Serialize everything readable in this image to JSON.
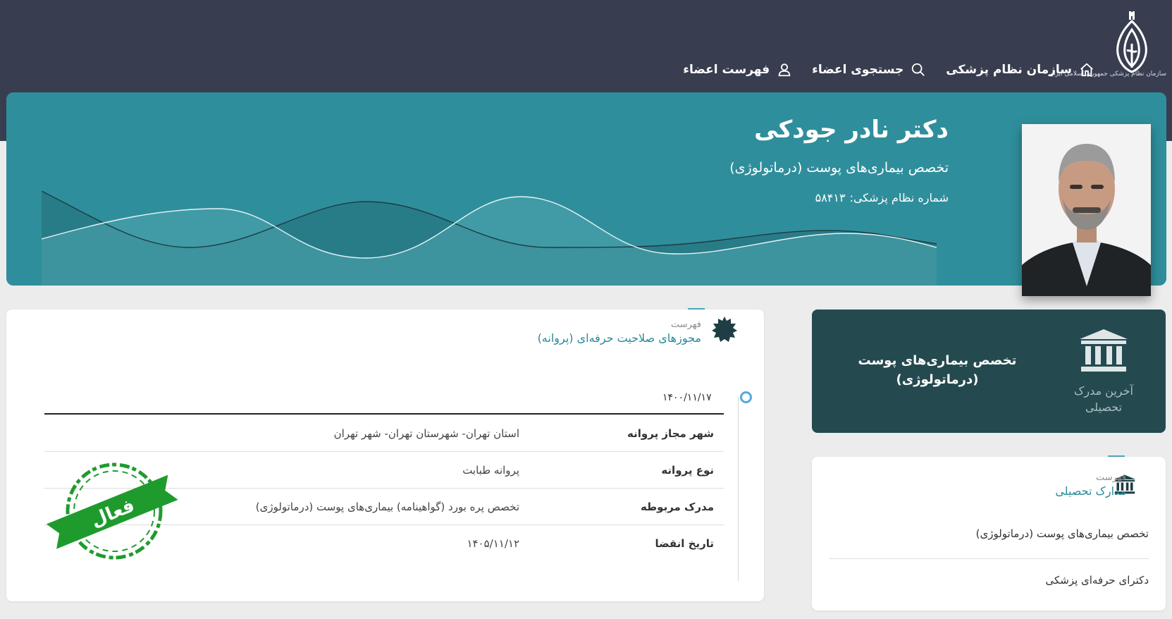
{
  "nav": {
    "home_label": "سازمان نظام پزشکی",
    "search_label": "جستجوی اعضاء",
    "members_label": "فهرست اعضاء",
    "logo_caption": "سازمان نظام پزشکی جمهوری اسلامی ایران"
  },
  "doctor": {
    "name": "دکتر نادر جودکی",
    "specialty": "تخصص بیماری‌های پوست (درماتولوژی)",
    "number_label": "شماره نظام پزشکی:",
    "number_value": "۵۸۴۱۳"
  },
  "license_section": {
    "subtitle": "فهرست",
    "title": "مجوزهای صلاحیت حرفه‌ای (پروانه)",
    "date": "۱۴۰۰/۱۱/۱۷",
    "rows": [
      {
        "label": "شهر مجاز پروانه",
        "value": "استان تهران- شهرستان تهران- شهر تهران"
      },
      {
        "label": "نوع پروانه",
        "value": "پروانه طبابت"
      },
      {
        "label": "مدرک مربوطه",
        "value": "تخصص پره بورد (گواهینامه) بیماری‌های پوست (درماتولوژی)"
      },
      {
        "label": "تاریخ انقضا",
        "value": "۱۴۰۵/۱۱/۱۲"
      }
    ],
    "stamp_label": "فعال"
  },
  "latest_degree": {
    "caption_line1": "آخرین مدرک",
    "caption_line2": "تحصیلی",
    "line1": "تخصص بیماری‌های پوست",
    "line2": "(درماتولوژی)"
  },
  "degrees_section": {
    "subtitle": "فهرست",
    "title": "مدارک تحصیلی",
    "items": [
      "تخصص بیماری‌های پوست (درماتولوژی)",
      "دکترای حرفه‌ای پزشکی"
    ]
  },
  "colors": {
    "topbar": "#383d50",
    "hero": "#2f8e9c",
    "dark_card": "#244a4f",
    "accent": "#2a8a99",
    "stamp": "#1f9b2e"
  }
}
